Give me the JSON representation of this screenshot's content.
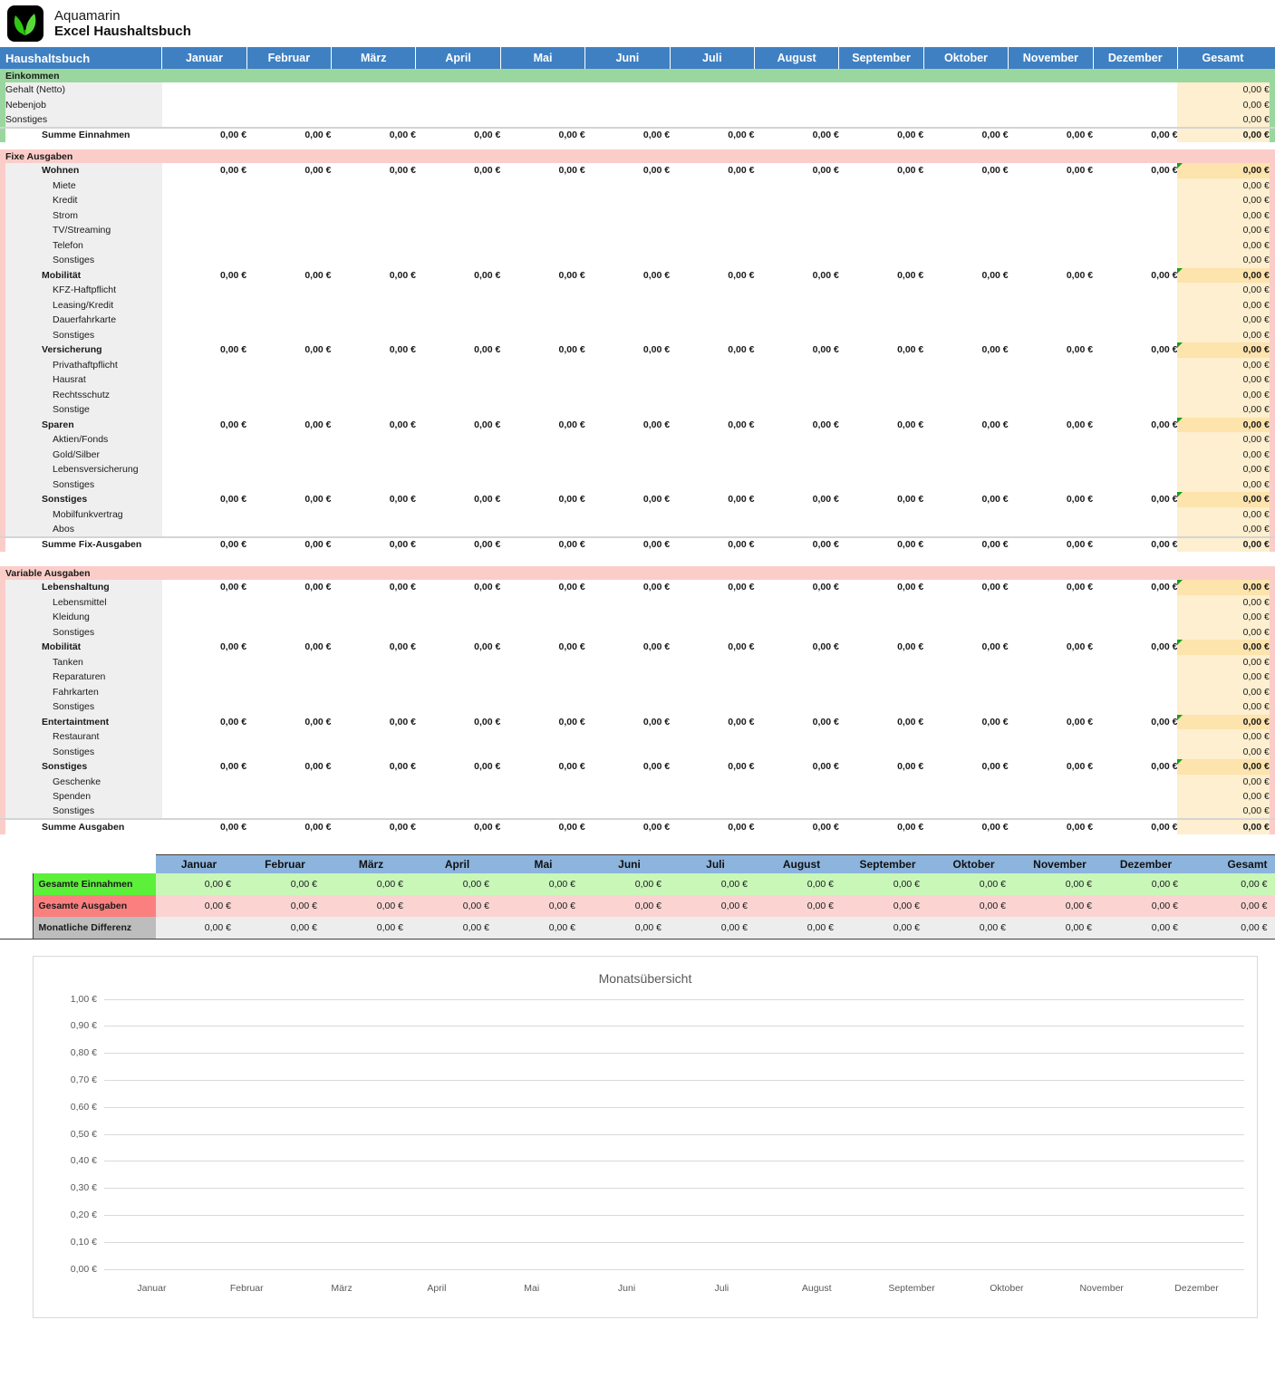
{
  "brand": {
    "line1": "Aquamarin",
    "line2": "Excel Haushaltsbuch",
    "logo_icon": "leaf-icon"
  },
  "header": {
    "label": "Haushaltsbuch",
    "months": [
      "Januar",
      "Februar",
      "März",
      "April",
      "Mai",
      "Juni",
      "Juli",
      "August",
      "September",
      "Oktober",
      "November",
      "Dezember"
    ],
    "total": "Gesamt"
  },
  "zero": "0,00 €",
  "sections": [
    {
      "band": "Einkommen",
      "band_color": "#9ad79e",
      "groups": [
        {
          "header": null,
          "items": [
            "Gehalt (Netto)",
            "Nebenjob",
            "Sonstiges"
          ]
        }
      ],
      "sum_label": "Summe Einnahmen"
    },
    {
      "band": "Fixe Ausgaben",
      "band_color": "#fbcdc9",
      "groups": [
        {
          "header": "Wohnen",
          "items": [
            "Miete",
            "Kredit",
            "Strom",
            "TV/Streaming",
            "Telefon",
            "Sonstiges"
          ]
        },
        {
          "header": "Mobilität",
          "items": [
            "KFZ-Haftpflicht",
            "Leasing/Kredit",
            "Dauerfahrkarte",
            "Sonstiges"
          ]
        },
        {
          "header": "Versicherung",
          "items": [
            "Privathaftpflicht",
            "Hausrat",
            "Rechtsschutz",
            "Sonstige"
          ]
        },
        {
          "header": "Sparen",
          "items": [
            "Aktien/Fonds",
            "Gold/Silber",
            "Lebensversicherung",
            "Sonstiges"
          ]
        },
        {
          "header": "Sonstiges",
          "items": [
            "Mobilfunkvertrag",
            "Abos"
          ]
        }
      ],
      "sum_label": "Summe Fix-Ausgaben"
    },
    {
      "band": "Variable Ausgaben",
      "band_color": "#fbcdc9",
      "groups": [
        {
          "header": "Lebenshaltung",
          "items": [
            "Lebensmittel",
            "Kleidung",
            "Sonstiges"
          ]
        },
        {
          "header": "Mobilität",
          "items": [
            "Tanken",
            "Reparaturen",
            "Fahrkarten",
            "Sonstiges"
          ]
        },
        {
          "header": "Entertaintment",
          "items": [
            "Restaurant",
            "Sonstiges"
          ]
        },
        {
          "header": "Sonstiges",
          "items": [
            "Geschenke",
            "Spenden",
            "Sonstiges"
          ]
        }
      ],
      "sum_label": "Summe Ausgaben"
    }
  ],
  "summary": {
    "months": [
      "Januar",
      "Februar",
      "März",
      "April",
      "Mai",
      "Juni",
      "Juli",
      "August",
      "September",
      "Oktober",
      "November",
      "Dezember"
    ],
    "total": "Gesamt",
    "rows": [
      {
        "label": "Gesamte Einnahmen",
        "label_color": "#5cf03a",
        "value_color": "#c8f7b8"
      },
      {
        "label": "Gesamte Ausgaben",
        "label_color": "#fa8080",
        "value_color": "#fbd4d2"
      },
      {
        "label": "Monatliche Differenz",
        "label_color": "#bdbdbd",
        "value_color": "#ededed"
      }
    ]
  },
  "chart_data": {
    "type": "bar",
    "title": "Monatsübersicht",
    "xlabel": "",
    "ylabel": "",
    "categories": [
      "Januar",
      "Februar",
      "März",
      "April",
      "Mai",
      "Juni",
      "Juli",
      "August",
      "September",
      "Oktober",
      "November",
      "Dezember"
    ],
    "series": [
      {
        "name": "Gesamte Einnahmen",
        "values": [
          0,
          0,
          0,
          0,
          0,
          0,
          0,
          0,
          0,
          0,
          0,
          0
        ]
      },
      {
        "name": "Gesamte Ausgaben",
        "values": [
          0,
          0,
          0,
          0,
          0,
          0,
          0,
          0,
          0,
          0,
          0,
          0
        ]
      }
    ],
    "yticks": [
      "0,00 €",
      "0,10 €",
      "0,20 €",
      "0,30 €",
      "0,40 €",
      "0,50 €",
      "0,60 €",
      "0,70 €",
      "0,80 €",
      "0,90 €",
      "1,00 €"
    ],
    "ylim": [
      0,
      1
    ],
    "grid": true,
    "legend": "none"
  }
}
